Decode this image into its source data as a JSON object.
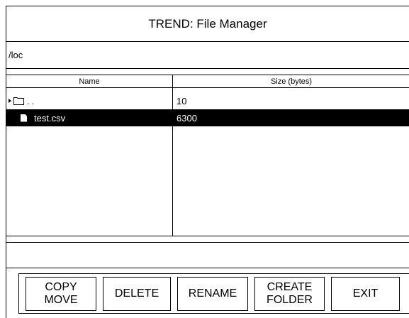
{
  "window": {
    "title": "TREND: File Manager"
  },
  "path": {
    "value": "/loc"
  },
  "table": {
    "columns": [
      "Name",
      "Size (bytes)"
    ],
    "rows": [
      {
        "name": "..",
        "size": "10",
        "icon": "folder-icon",
        "selected": false
      },
      {
        "name": "test.csv",
        "size": "6300",
        "icon": "file-icon",
        "selected": true
      }
    ]
  },
  "status": {
    "text": ""
  },
  "buttons": {
    "copy_move": "COPY\nMOVE",
    "delete": "DELETE",
    "rename": "RENAME",
    "create_folder": "CREATE\nFOLDER",
    "exit": "EXIT"
  },
  "colors": {
    "selected_bg": "#000000",
    "selected_fg": "#ffffff",
    "background": "#ffffff"
  }
}
